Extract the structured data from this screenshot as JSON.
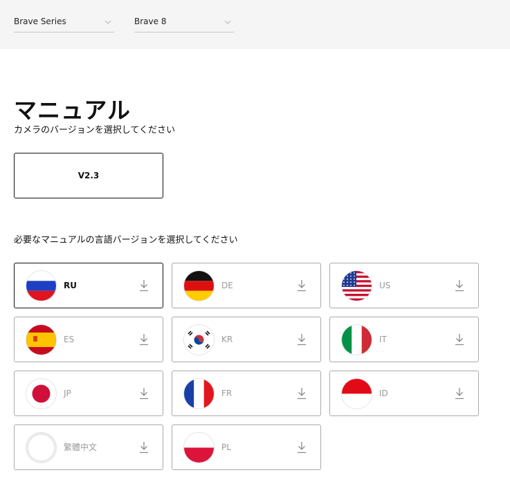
{
  "filters": {
    "series": "Brave Series",
    "model": "Brave 8"
  },
  "header": {
    "title": "マニュアル",
    "subtitle": "カメラのバージョンを選択してください"
  },
  "version": {
    "selected": "V2.3"
  },
  "languages": {
    "title": "必要なマニュアルの言語バージョンを選択してください",
    "items": [
      {
        "code": "RU",
        "flag": "russia-flag",
        "selected": true
      },
      {
        "code": "DE",
        "flag": "germany-flag"
      },
      {
        "code": "US",
        "flag": "usa-flag"
      },
      {
        "code": "ES",
        "flag": "spain-flag"
      },
      {
        "code": "KR",
        "flag": "korea-flag"
      },
      {
        "code": "IT",
        "flag": "italy-flag"
      },
      {
        "code": "JP",
        "flag": "japan-flag"
      },
      {
        "code": "FR",
        "flag": "france-flag"
      },
      {
        "code": "ID",
        "flag": "indonesia-flag"
      },
      {
        "code": "繁體中文",
        "flag": "blank-flag"
      },
      {
        "code": "PL",
        "flag": "poland-flag"
      }
    ]
  },
  "colors": {
    "topbar_bg": "#f5f5f5",
    "card_border": "#a9a9a9",
    "selected_border": "#111111",
    "muted_text": "#9a9a9a"
  }
}
